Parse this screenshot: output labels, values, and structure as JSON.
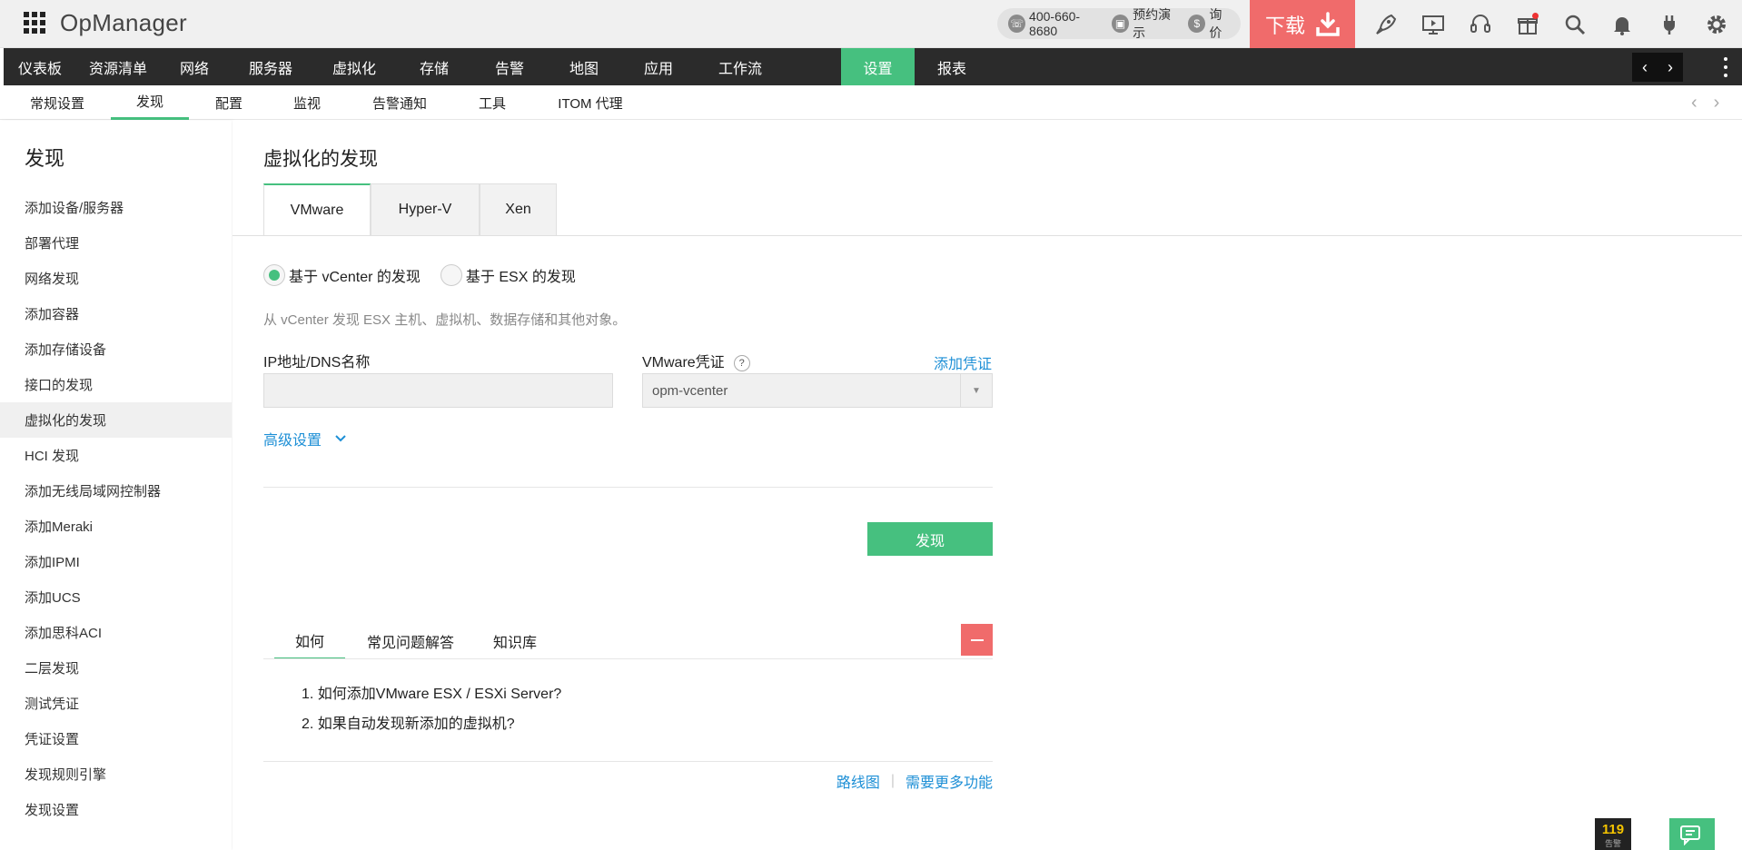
{
  "header": {
    "app_name": "OpManager",
    "phone": "400-660-8680",
    "demo_label": "预约演示",
    "price_label": "询价",
    "download_label": "下载"
  },
  "main_nav": {
    "items": [
      "仪表板",
      "资源清单",
      "网络",
      "服务器",
      "虚拟化",
      "存储",
      "告警",
      "地图",
      "应用",
      "工作流",
      "设置",
      "报表"
    ],
    "active": "设置"
  },
  "sub_nav": {
    "items": [
      "常规设置",
      "发现",
      "配置",
      "监视",
      "告警通知",
      "工具",
      "ITOM 代理"
    ],
    "active": "发现"
  },
  "sidebar": {
    "title": "发现",
    "items": [
      "添加设备/服务器",
      "部署代理",
      "网络发现",
      "添加容器",
      "添加存储设备",
      "接口的发现",
      "虚拟化的发现",
      "HCI 发现",
      "添加无线局域网控制器",
      "添加Meraki",
      "添加IPMI",
      "添加UCS",
      "添加思科ACI",
      "二层发现",
      "测试凭证",
      "凭证设置",
      "发现规则引擎",
      "发现设置"
    ],
    "active": "虚拟化的发现"
  },
  "content": {
    "title": "虚拟化的发现",
    "tabs": [
      "VMware",
      "Hyper-V",
      "Xen"
    ],
    "active_tab": "VMware",
    "radio": {
      "option1": "基于 vCenter 的发现",
      "option2": "基于 ESX 的发现",
      "selected": "option1"
    },
    "description": "从 vCenter 发现 ESX 主机、虚拟机、数据存储和其他对象。",
    "ip_label": "IP地址/DNS名称",
    "ip_value": "",
    "cred_label": "VMware凭证",
    "help_mark": "?",
    "add_cred_link": "添加凭证",
    "cred_selected": "opm-vcenter",
    "advanced_label": "高级设置",
    "discover_button": "发现",
    "help_tabs": [
      "如何",
      "常见问题解答",
      "知识库"
    ],
    "help_active": "如何",
    "help_items": [
      "1. 如何添加VMware ESX / ESXi Server?",
      "2. 如果自动发现新添加的虚拟机?"
    ],
    "footer_links": [
      "路线图",
      "需要更多功能"
    ],
    "footer_separator": "|"
  },
  "widgets": {
    "alarm_count": "119",
    "alarm_label": "告警"
  },
  "colors": {
    "accent": "#46c07f",
    "download": "#f06b6b",
    "nav_bg": "#2b2b2b",
    "link": "#1d8fd6"
  }
}
